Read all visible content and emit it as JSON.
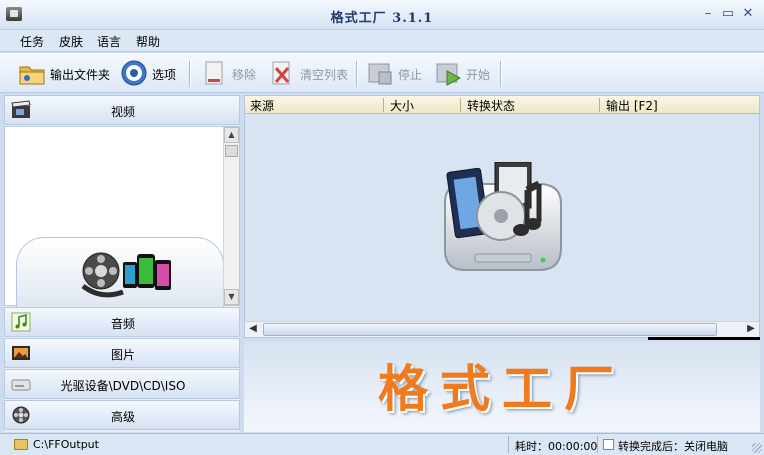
{
  "window": {
    "title": "格式工厂  3.1.1"
  },
  "menu": [
    "任务",
    "皮肤",
    "语言",
    "帮助"
  ],
  "toolbar": {
    "output_folder": "输出文件夹",
    "options": "选项",
    "remove": "移除",
    "clear_list": "清空列表",
    "stop": "停止",
    "start": "开始"
  },
  "sidebar": {
    "categories": [
      "视频",
      "音频",
      "图片",
      "光驱设备\\DVD\\CD\\ISO",
      "高级"
    ]
  },
  "table": {
    "columns": [
      "来源",
      "大小",
      "转换状态",
      "输出 [F2]"
    ]
  },
  "banner": {
    "text": "格式工厂"
  },
  "status": {
    "path": "C:\\FFOutput",
    "elapsed": "耗时：00:00:00",
    "after_done": "转换完成后：关闭电脑"
  },
  "colors": {
    "accent": "#f07a1c",
    "chrome": "#dce7f6"
  }
}
